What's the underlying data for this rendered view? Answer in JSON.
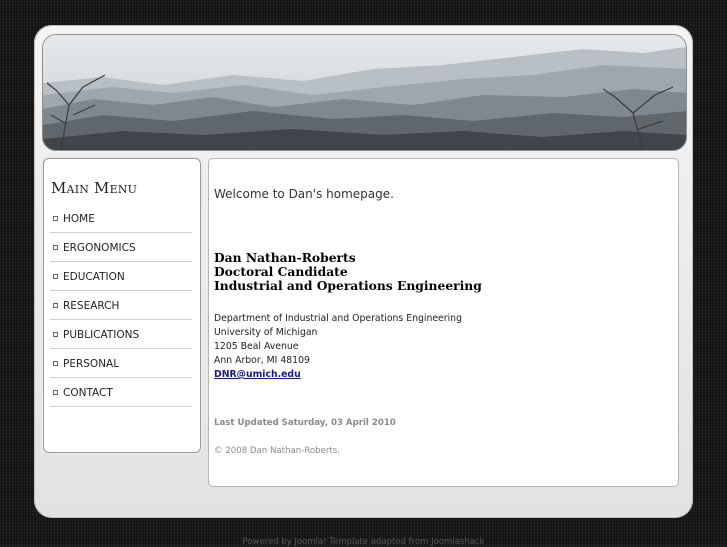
{
  "menu": {
    "title": "Main Menu",
    "items": [
      {
        "label": "HOME"
      },
      {
        "label": "ERGONOMICS"
      },
      {
        "label": "EDUCATION"
      },
      {
        "label": "RESEARCH"
      },
      {
        "label": "PUBLICATIONS"
      },
      {
        "label": "PERSONAL"
      },
      {
        "label": "CONTACT"
      }
    ]
  },
  "content": {
    "welcome": "Welcome to Dan's homepage.",
    "name": "Dan Nathan-Roberts",
    "title_role": "Doctoral Candidate",
    "department_heading": "Industrial and Operations Engineering",
    "address": {
      "department": "Department of Industrial and Operations Engineering",
      "university": "University of Michigan",
      "street": "1205 Beal Avenue",
      "city": "Ann Arbor, MI 48109",
      "email": "DNR@umich.edu"
    },
    "last_updated": "Last Updated Saturday, 03 April 2010",
    "copyright": "© 2008 Dan Nathan-Roberts."
  },
  "footer": {
    "text": "Powered by Joomla! Template adapted from Joomlashack"
  },
  "colors": {
    "page_bg": "#141414",
    "wrapper_bg": "#ececec",
    "link": "#1a1a8a",
    "muted": "#8a8a8a"
  }
}
